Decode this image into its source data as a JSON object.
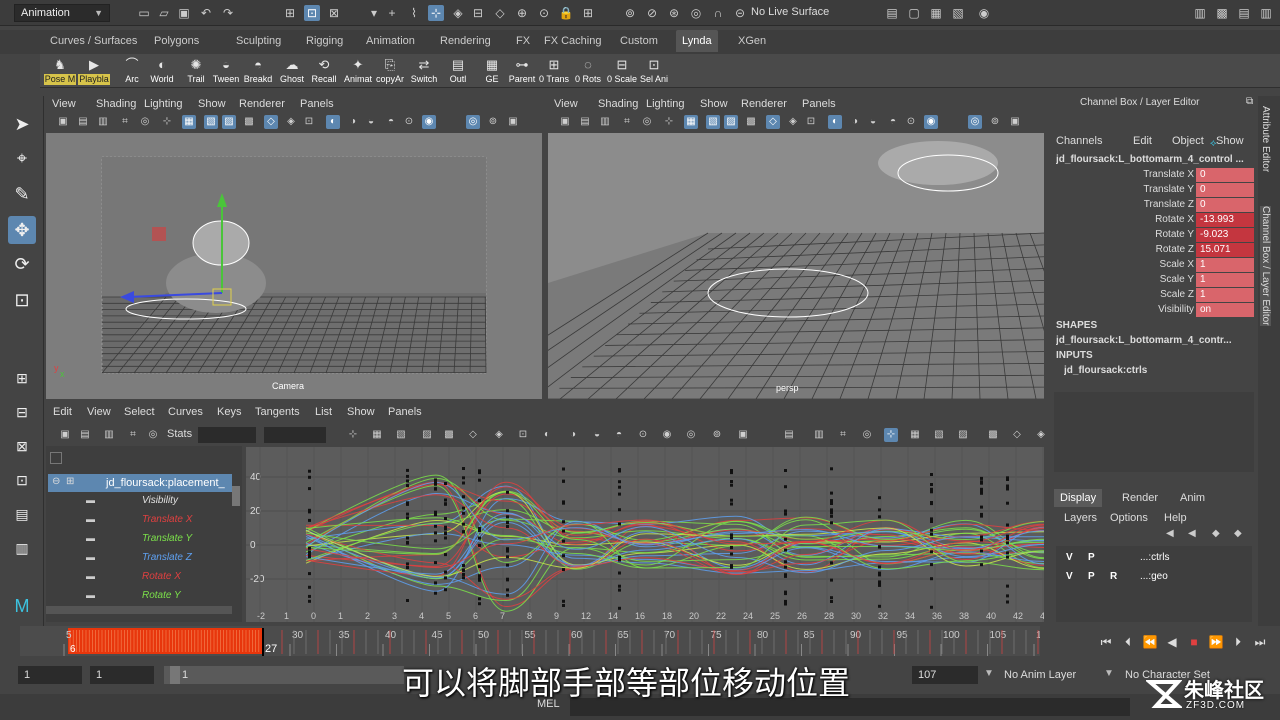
{
  "top_bar": {
    "mode": "Animation",
    "live_surface": "No Live Surface"
  },
  "shelf": {
    "tabs": [
      "Curves / Surfaces",
      "Polygons",
      "Sculpting",
      "Rigging",
      "Animation",
      "Rendering",
      "FX",
      "FX Caching",
      "Custom",
      "Lynda",
      "XGen"
    ],
    "active_tab": "Lynda",
    "buttons": [
      {
        "label": "Pose M",
        "icon": "pose-icon",
        "style": "yellow"
      },
      {
        "label": "Playbla",
        "icon": "playblast-icon",
        "style": "yellow"
      },
      {
        "label": "Arc",
        "icon": "arc-icon",
        "style": ""
      },
      {
        "label": "World",
        "icon": "world-icon",
        "style": ""
      },
      {
        "label": "Trail",
        "icon": "trail-icon",
        "style": ""
      },
      {
        "label": "Tween",
        "icon": "tween-icon",
        "style": ""
      },
      {
        "label": "Breakd",
        "icon": "breakdown-icon",
        "style": ""
      },
      {
        "label": "Ghost",
        "icon": "ghost-icon",
        "style": ""
      },
      {
        "label": "Recall",
        "icon": "recall-icon",
        "style": ""
      },
      {
        "label": "Animat",
        "icon": "animat-icon",
        "style": ""
      },
      {
        "label": "copyAr",
        "icon": "copy-icon",
        "style": ""
      },
      {
        "label": "Switch",
        "icon": "switch-icon",
        "style": ""
      },
      {
        "label": "Outl",
        "icon": "outliner-icon",
        "style": ""
      },
      {
        "label": "GE",
        "icon": "graph-editor-icon",
        "style": ""
      },
      {
        "label": "Parent",
        "icon": "parent-icon",
        "style": ""
      },
      {
        "label": "0 Trans",
        "icon": "zero-trans-icon",
        "style": ""
      },
      {
        "label": "0 Rots",
        "icon": "zero-rots-icon",
        "style": ""
      },
      {
        "label": "0 Scale",
        "icon": "zero-scale-icon",
        "style": ""
      },
      {
        "label": "Sel Ani",
        "icon": "select-anim-icon",
        "style": ""
      }
    ]
  },
  "viewport_left": {
    "menu": [
      "View",
      "Shading",
      "Lighting",
      "Show",
      "Renderer",
      "Panels"
    ],
    "label": "Camera"
  },
  "viewport_right": {
    "menu": [
      "View",
      "Shading",
      "Lighting",
      "Show",
      "Renderer",
      "Panels"
    ],
    "label": "persp"
  },
  "channel_box": {
    "title": "Channel Box / Layer Editor",
    "menu": [
      "Channels",
      "Edit",
      "Object",
      "Show"
    ],
    "object": "jd_floursack:L_bottomarm_4_control ...",
    "attributes": [
      {
        "name": "Translate X",
        "value": "0",
        "kind": ""
      },
      {
        "name": "Translate Y",
        "value": "0",
        "kind": ""
      },
      {
        "name": "Translate Z",
        "value": "0",
        "kind": ""
      },
      {
        "name": "Rotate X",
        "value": "-13.993",
        "kind": "rot"
      },
      {
        "name": "Rotate Y",
        "value": "-9.023",
        "kind": "rot"
      },
      {
        "name": "Rotate Z",
        "value": "15.071",
        "kind": "rot"
      },
      {
        "name": "Scale X",
        "value": "1",
        "kind": ""
      },
      {
        "name": "Scale Y",
        "value": "1",
        "kind": ""
      },
      {
        "name": "Scale Z",
        "value": "1",
        "kind": ""
      },
      {
        "name": "Visibility",
        "value": "on",
        "kind": ""
      }
    ],
    "shapes_header": "SHAPES",
    "shape_node": "jd_floursack:L_bottomarm_4_contr...",
    "inputs_header": "INPUTS",
    "input_node": "jd_floursack:ctrls"
  },
  "side_tabs": [
    "Attribute Editor",
    "Channel Box / Layer Editor"
  ],
  "layer_editor": {
    "tabs": [
      "Display",
      "Render",
      "Anim"
    ],
    "active_tab": "Display",
    "menu": [
      "Layers",
      "Options",
      "Help"
    ],
    "layers": [
      {
        "v": "V",
        "p": "P",
        "r": "",
        "name": "...:ctrls"
      },
      {
        "v": "V",
        "p": "P",
        "r": "R",
        "name": "...:geo"
      }
    ]
  },
  "graph_editor": {
    "menu": [
      "Edit",
      "View",
      "Select",
      "Curves",
      "Keys",
      "Tangents",
      "List",
      "Show",
      "Panels"
    ],
    "stats_label": "Stats",
    "outliner": {
      "root": "jd_floursack:placement_",
      "channels": [
        {
          "name": "Visibility",
          "color": "#e0e0e0"
        },
        {
          "name": "Translate X",
          "color": "#e04040"
        },
        {
          "name": "Translate Y",
          "color": "#7be04a"
        },
        {
          "name": "Translate Z",
          "color": "#5ea0f0"
        },
        {
          "name": "Rotate X",
          "color": "#e04040"
        },
        {
          "name": "Rotate Y",
          "color": "#7be04a"
        }
      ]
    },
    "y_ticks": [
      "40",
      "20",
      "0",
      "-20"
    ],
    "x_ticks": [
      "-2",
      "1",
      "0",
      "1",
      "2",
      "3",
      "4",
      "5",
      "6",
      "7",
      "8",
      "9",
      "12",
      "14",
      "16",
      "18",
      "20",
      "22",
      "24",
      "25",
      "26",
      "28",
      "30",
      "32",
      "34",
      "36",
      "38",
      "40",
      "42",
      "44"
    ]
  },
  "timeline": {
    "ticks": [
      "5",
      "30",
      "35",
      "40",
      "45",
      "50",
      "55",
      "60",
      "65",
      "70",
      "75",
      "80",
      "85",
      "90",
      "95",
      "100",
      "105",
      "10"
    ],
    "selection_start_label": "6",
    "current_frame": "27"
  },
  "range_bar": {
    "start": "1",
    "playback_start": "1",
    "slider_value": "1",
    "end": "107",
    "anim_layer": "No Anim Layer",
    "character_set": "No Character Set"
  },
  "subtitle": "可以将脚部手部等部位移动位置",
  "command_line": {
    "label": "MEL"
  },
  "watermark": {
    "text": "朱峰社区",
    "url": "ZF3D.COM"
  }
}
